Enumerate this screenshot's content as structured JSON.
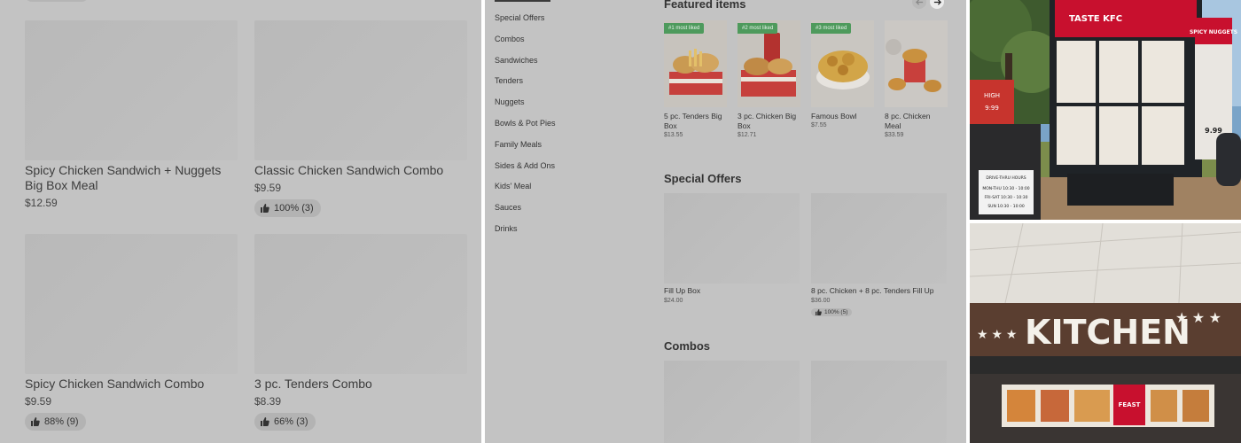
{
  "left_panel": {
    "cards": [
      {
        "name": "Spicy Chicken Sandwich + Nuggets Big Box Meal",
        "price": "$12.59",
        "rating": ""
      },
      {
        "name": "Classic Chicken Sandwich Combo",
        "price": "$9.59",
        "rating": "100% (3)"
      },
      {
        "name": "Spicy Chicken Sandwich Combo",
        "price": "$9.59",
        "rating": "88% (9)"
      },
      {
        "name": "3 pc. Tenders Combo",
        "price": "$8.39",
        "rating": "66% (3)"
      }
    ]
  },
  "middle_panel": {
    "categories": [
      "Special Offers",
      "Combos",
      "Sandwiches",
      "Tenders",
      "Nuggets",
      "Bowls & Pot Pies",
      "Family Meals",
      "Sides & Add Ons",
      "Kids' Meal",
      "Sauces",
      "Drinks"
    ],
    "featured_title": "Featured items",
    "featured": [
      {
        "badge": "#1 most liked",
        "name": "5 pc. Tenders Big Box",
        "price": "$13.55"
      },
      {
        "badge": "#2 most liked",
        "name": "3 pc. Chicken Big Box",
        "price": "$12.71"
      },
      {
        "badge": "#3 most liked",
        "name": "Famous Bowl",
        "price": "$7.55"
      },
      {
        "badge": "",
        "name": "8 pc. Chicken Meal",
        "price": "$33.59"
      }
    ],
    "special_offers_title": "Special Offers",
    "special_offers": [
      {
        "name": "Fill Up Box",
        "price": "$24.00",
        "rating": ""
      },
      {
        "name": "8 pc. Chicken + 8 pc. Tenders Fill Up",
        "price": "$36.00",
        "rating": "100% (5)"
      }
    ],
    "combos_title": "Combos",
    "icons": {
      "prev": "arrow-left-icon",
      "next": "arrow-right-icon",
      "thumb": "thumbs-up-icon"
    }
  },
  "right_panel": {
    "menu_board": {
      "header_text": "TASTE KFC",
      "side_sign": "SPICY NUGGETS",
      "side_price": "9.99",
      "hours_sign": "DRIVE-THRU HOURS",
      "hours_rows": [
        "MON-THU 10:30 - 10:00",
        "FRI-SAT 10:30 - 10:30",
        "SUN 10:30 - 10:00"
      ],
      "small_sign_top": "HIGH",
      "small_sign_bottom": "9:99"
    },
    "kitchen_sign": {
      "text": "KITCHEN",
      "board_label": "FEAST"
    }
  },
  "colors": {
    "panel_bg": "#c3c3c3",
    "badge_green": "#4e9a5c",
    "kfc_red": "#c8102e"
  }
}
